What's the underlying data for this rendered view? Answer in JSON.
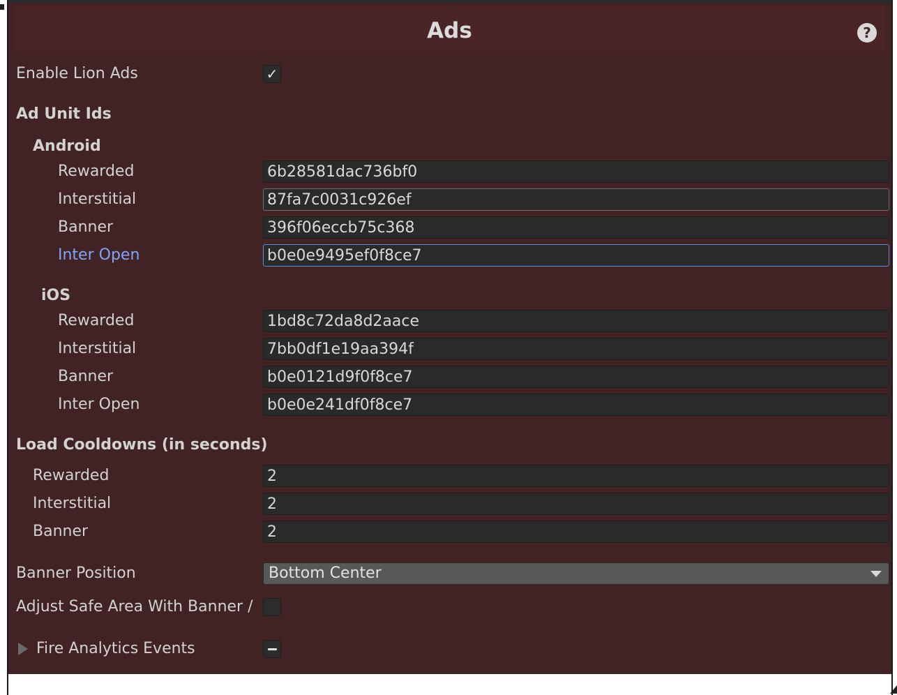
{
  "header": {
    "title": "Ads",
    "help_icon": "help-icon"
  },
  "enable_lion_ads": {
    "label": "Enable Lion Ads",
    "checked": true,
    "mark": "✓"
  },
  "ad_unit_ids": {
    "title": "Ad Unit Ids",
    "android": {
      "title": "Android",
      "rewarded": {
        "label": "Rewarded",
        "value": "6b28581dac736bf0"
      },
      "interstitial": {
        "label": "Interstitial",
        "value": "87fa7c0031c926ef"
      },
      "banner": {
        "label": "Banner",
        "value": "396f06eccb75c368"
      },
      "inter_open": {
        "label": "Inter Open",
        "value": "b0e0e9495ef0f8ce7"
      }
    },
    "ios": {
      "title": "iOS",
      "rewarded": {
        "label": "Rewarded",
        "value": "1bd8c72da8d2aace"
      },
      "interstitial": {
        "label": "Interstitial",
        "value": "7bb0df1e19aa394f"
      },
      "banner": {
        "label": "Banner",
        "value": "b0e0121d9f0f8ce7"
      },
      "inter_open": {
        "label": "Inter Open",
        "value": "b0e0e241df0f8ce7"
      }
    }
  },
  "load_cooldowns": {
    "title": "Load Cooldowns (in seconds)",
    "rewarded": {
      "label": "Rewarded",
      "value": "2"
    },
    "interstitial": {
      "label": "Interstitial",
      "value": "2"
    },
    "banner": {
      "label": "Banner",
      "value": "2"
    }
  },
  "banner_position": {
    "label": "Banner Position",
    "value": "Bottom Center"
  },
  "adjust_safe_area": {
    "label": "Adjust Safe Area With Banner /",
    "checked": false
  },
  "fire_analytics_events": {
    "label": "Fire Analytics Events",
    "state": "mixed"
  },
  "colors": {
    "panel_bg": "#412326",
    "header_bg": "#4a2528",
    "active_label": "#7ea6f5",
    "focus_border": "#5c8be0"
  }
}
